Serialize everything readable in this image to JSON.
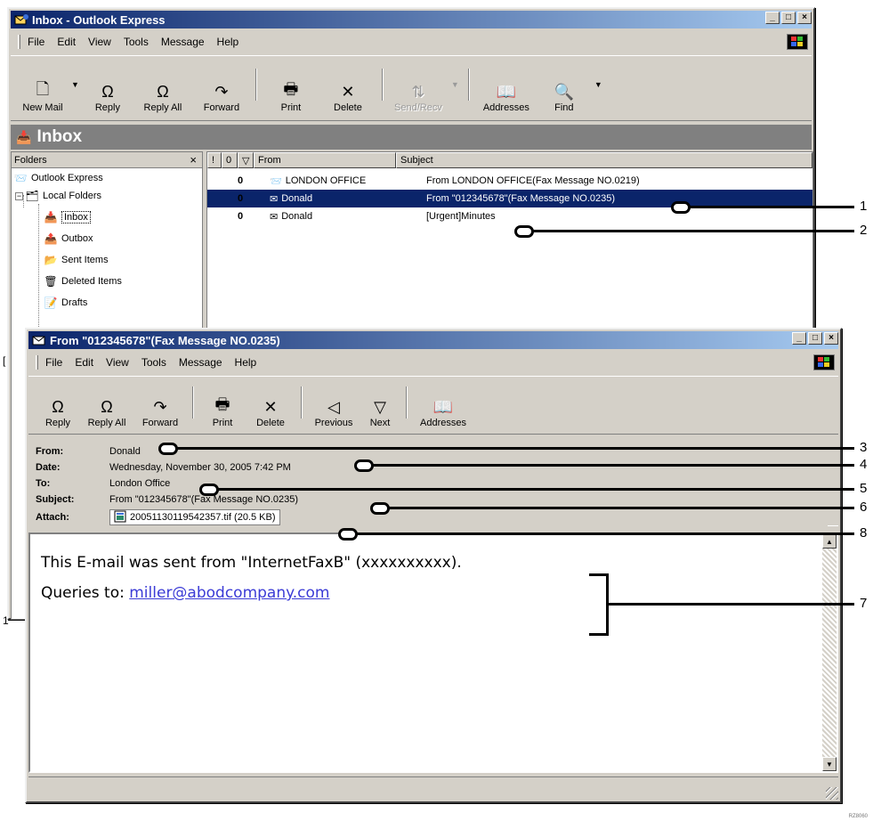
{
  "main_window": {
    "title": "Inbox - Outlook Express",
    "menu": [
      "File",
      "Edit",
      "View",
      "Tools",
      "Message",
      "Help"
    ],
    "toolbar": [
      {
        "label": "New Mail",
        "icon": "new-mail-icon"
      },
      {
        "label": "Reply",
        "icon": "reply-icon"
      },
      {
        "label": "Reply All",
        "icon": "reply-all-icon"
      },
      {
        "label": "Forward",
        "icon": "forward-icon"
      },
      {
        "label": "Print",
        "icon": "print-icon"
      },
      {
        "label": "Delete",
        "icon": "delete-icon"
      },
      {
        "label": "Send/Recv",
        "icon": "send-recv-icon"
      },
      {
        "label": "Addresses",
        "icon": "addresses-icon"
      },
      {
        "label": "Find",
        "icon": "find-icon"
      }
    ],
    "banner": "Inbox",
    "folders_header": "Folders",
    "folders_close": "×",
    "folders": [
      "Outlook Express",
      "Local Folders",
      "Inbox",
      "Outbox",
      "Sent Items",
      "Deleted Items",
      "Drafts"
    ],
    "columns": [
      "!",
      "0",
      "▽",
      "From",
      "Subject"
    ],
    "messages": [
      {
        "clip": "0",
        "from": "LONDON OFFICE",
        "subject": "From LONDON OFFICE(Fax Message NO.0219)"
      },
      {
        "clip": "0",
        "from": "Donald",
        "subject": "From \"012345678\"(Fax Message NO.0235)"
      },
      {
        "clip": "0",
        "from": "Donald",
        "subject": "[Urgent]Minutes"
      }
    ]
  },
  "message_window": {
    "title": "From \"012345678\"(Fax Message NO.0235)",
    "menu": [
      "File",
      "Edit",
      "View",
      "Tools",
      "Message",
      "Help"
    ],
    "toolbar": [
      {
        "label": "Reply",
        "icon": "reply-icon"
      },
      {
        "label": "Reply All",
        "icon": "reply-all-icon"
      },
      {
        "label": "Forward",
        "icon": "forward-icon"
      },
      {
        "label": "Print",
        "icon": "print-icon"
      },
      {
        "label": "Delete",
        "icon": "delete-icon"
      },
      {
        "label": "Previous",
        "icon": "previous-icon"
      },
      {
        "label": "Next",
        "icon": "next-icon"
      },
      {
        "label": "Addresses",
        "icon": "addresses-icon"
      }
    ],
    "headers": {
      "from_label": "From:",
      "from": "Donald",
      "date_label": "Date:",
      "date": "Wednesday, November 30, 2005 7:42 PM",
      "to_label": "To:",
      "to": "London Office",
      "subject_label": "Subject:",
      "subject": "From \"012345678\"(Fax Message NO.0235)",
      "attach_label": "Attach:",
      "attachment": "20051130119542357.tif (20.5 KB)"
    },
    "body": {
      "line1": "This E-mail was sent from \"InternetFaxB\" (xxxxxxxxxx).",
      "line2_prefix": "Queries to: ",
      "line2_link": "miller@abodcompany.com"
    }
  },
  "side_fragments": [
    "[",
    "1"
  ],
  "callouts": [
    "1",
    "2",
    "3",
    "4",
    "5",
    "6",
    "7",
    "8"
  ],
  "image_code": "RZ8060"
}
